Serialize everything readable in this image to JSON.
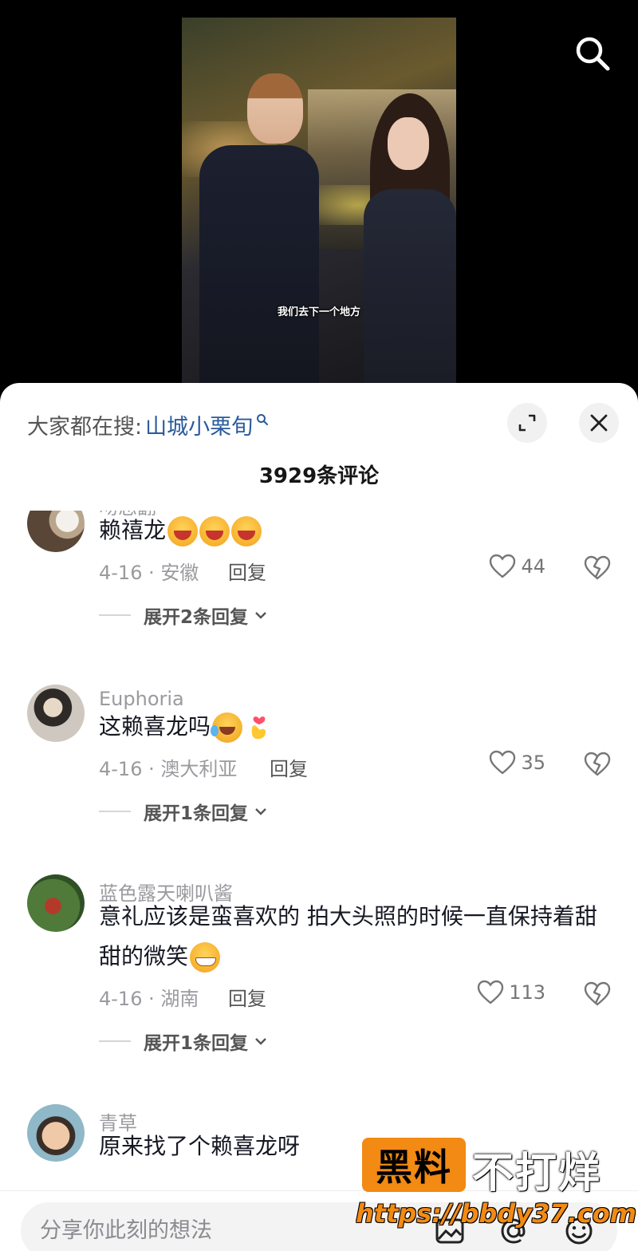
{
  "video": {
    "caption": "我们去下一个地方"
  },
  "header": {
    "search_label": "大家都在搜:",
    "search_keyword": "山城小栗旬"
  },
  "comments_count": "3929条评论",
  "comments": [
    {
      "username": "吻恋翻",
      "text": "赖禧龙",
      "emojis": [
        "laugh",
        "laugh",
        "laugh"
      ],
      "date_location": "4-16 · 安徽",
      "reply_label": "回复",
      "likes": "44",
      "expand_label": "展开2条回复"
    },
    {
      "username": "Euphoria",
      "text": "这赖喜龙吗",
      "emojis": [
        "cry-laugh",
        "heart-hand"
      ],
      "date_location": "4-16 · 澳大利亚",
      "reply_label": "回复",
      "likes": "35",
      "expand_label": "展开1条回复"
    },
    {
      "username": "蓝色露天喇叭酱",
      "text": "意礼应该是蛮喜欢的 拍大头照的时候一直保持着甜甜的微笑",
      "emojis": [
        "grin"
      ],
      "date_location": "4-16 · 湖南",
      "reply_label": "回复",
      "likes": "113",
      "expand_label": "展开1条回复"
    },
    {
      "username": "青草",
      "text": "原来找了个赖喜龙呀",
      "emojis": [],
      "date_location": "",
      "reply_label": "",
      "likes": "",
      "expand_label": ""
    }
  ],
  "input": {
    "placeholder": "分享你此刻的想法"
  },
  "watermark": {
    "box_text": "黑料",
    "side_text": "不打烊",
    "url": "https://bbdy37.com"
  },
  "colors": {
    "keyword": "#2a5a9c",
    "watermark_orange": "#f28a13"
  },
  "icons": [
    "search-icon",
    "expand-icon",
    "close-icon",
    "heart-icon",
    "broken-heart-icon",
    "chevron-down-icon",
    "image-icon",
    "at-icon",
    "emoji-icon"
  ]
}
